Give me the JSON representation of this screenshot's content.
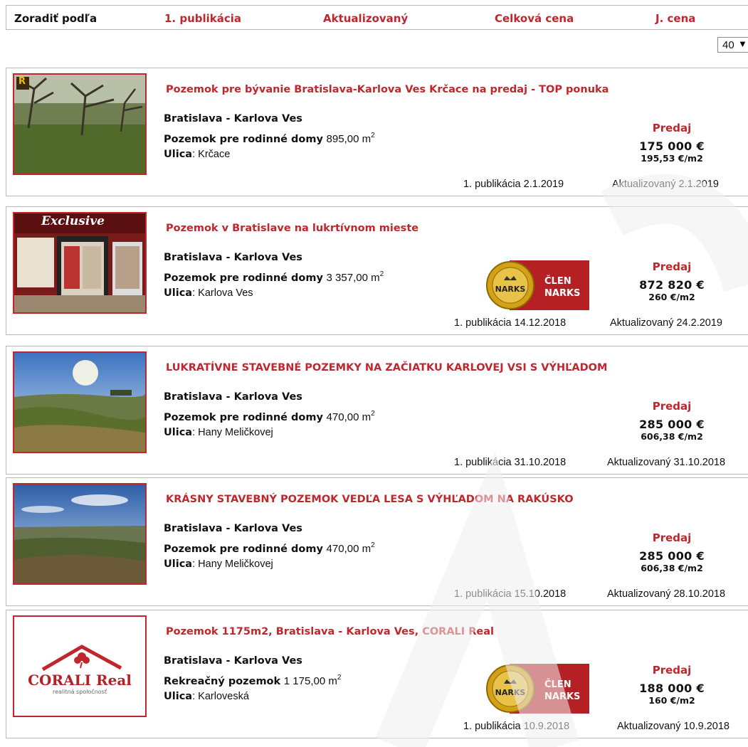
{
  "sort": {
    "label": "Zoradiť podľa",
    "options": [
      "1. publikácia",
      "Aktualizovaný",
      "Celková cena",
      "J. cena"
    ]
  },
  "per_page": {
    "value": "40"
  },
  "listings": [
    {
      "title": "Pozemok pre bývanie Bratislava-Karlova Ves Krčace na predaj - TOP ponuka",
      "location": "Bratislava - Karlova Ves",
      "type": "Pozemok pre rodinné domy",
      "area": "895,00 m",
      "area_sup": "2",
      "street_label": "Ulica",
      "street": ": Krčace",
      "deal": "Predaj",
      "price": "175 000 €",
      "unit_price": "195,53 €/m2",
      "published": "1. publikácia 2.1.2019",
      "updated": "Aktualizovaný 2.1.2019",
      "thumb_badge": "R",
      "narks": false
    },
    {
      "title": "Pozemok v Bratislave na lukrtívnom mieste",
      "location": "Bratislava - Karlova Ves",
      "type": "Pozemok pre rodinné domy",
      "area": "3 357,00 m",
      "area_sup": "2",
      "street_label": "Ulica",
      "street": ": Karlova Ves",
      "deal": "Predaj",
      "price": "872 820 €",
      "unit_price": "260 €/m2",
      "published": "1. publikácia 14.12.2018",
      "updated": "Aktualizovaný 24.2.2019",
      "thumb_badge": "Exclusive",
      "narks": true
    },
    {
      "title": "LUKRATÍVNE STAVEBNÉ POZEMKY NA ZAČIATKU KARLOVEJ VSI S VÝHĽADOM",
      "location": "Bratislava - Karlova Ves",
      "type": "Pozemok pre rodinné domy",
      "area": "470,00 m",
      "area_sup": "2",
      "street_label": "Ulica",
      "street": ": Hany Meličkovej",
      "deal": "Predaj",
      "price": "285 000 €",
      "unit_price": "606,38 €/m2",
      "published": "1. publikácia 31.10.2018",
      "updated": "Aktualizovaný 31.10.2018",
      "narks": false
    },
    {
      "title": "KRÁSNY STAVEBNÝ POZEMOK VEDĽA LESA S VÝHĽADOM NA RAKÚSKO",
      "location": "Bratislava - Karlova Ves",
      "type": "Pozemok pre rodinné domy",
      "area": "470,00 m",
      "area_sup": "2",
      "street_label": "Ulica",
      "street": ": Hany Meličkovej",
      "deal": "Predaj",
      "price": "285 000 €",
      "unit_price": "606,38 €/m2",
      "published": "1. publikácia 15.10.2018",
      "updated": "Aktualizovaný 28.10.2018",
      "narks": false
    },
    {
      "title": "Pozemok 1175m2, Bratislava - Karlova Ves, CORALI Real",
      "location": "Bratislava - Karlova Ves",
      "type": "Rekreačný pozemok",
      "area": "1 175,00 m",
      "area_sup": "2",
      "street_label": "Ulica",
      "street": ": Karloveská",
      "deal": "Predaj",
      "price": "188 000 €",
      "unit_price": "160 €/m2",
      "published": "1. publikácia 10.9.2018",
      "updated": "Aktualizovaný 10.9.2018",
      "thumb_logo": [
        "CORALI Real",
        "realitná spoločnosť"
      ],
      "narks": true
    }
  ],
  "narks_badge": {
    "word1": "ČLEN",
    "word2": "NARKS",
    "seal": "NARKS"
  },
  "colors": {
    "accent": "#c0272d",
    "border": "#b9b9b9"
  }
}
